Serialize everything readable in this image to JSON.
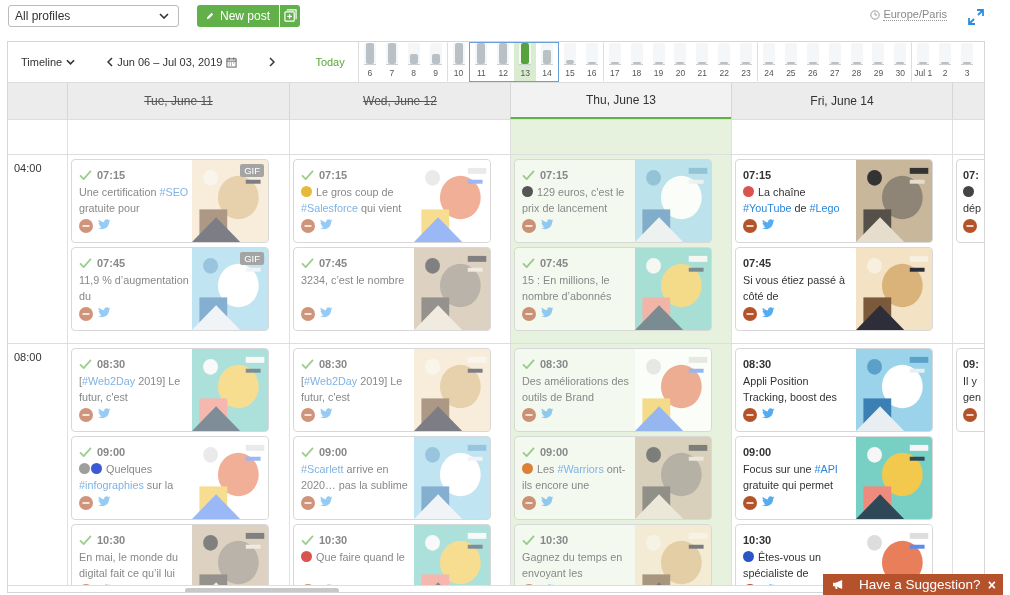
{
  "profile_select": {
    "value": "All profiles"
  },
  "new_post_button": {
    "label": "New post"
  },
  "timezone": "Europe/Paris",
  "toolbar": {
    "view": "Timeline",
    "date_range": "Jun 06 – Jul 03, 2019",
    "today": "Today"
  },
  "day_strip": [
    {
      "label": "6",
      "level": 1,
      "week_start": false,
      "in_range": false,
      "today": false
    },
    {
      "label": "7",
      "level": 1,
      "week_start": false,
      "in_range": false,
      "today": false
    },
    {
      "label": "8",
      "level": 0.5,
      "week_start": false,
      "in_range": false,
      "today": false
    },
    {
      "label": "9",
      "level": 0.5,
      "week_start": false,
      "in_range": false,
      "today": false
    },
    {
      "label": "10",
      "level": 1,
      "week_start": true,
      "in_range": false,
      "today": false
    },
    {
      "label": "11",
      "level": 1,
      "week_start": false,
      "in_range": true,
      "today": false
    },
    {
      "label": "12",
      "level": 1,
      "week_start": false,
      "in_range": true,
      "today": false
    },
    {
      "label": "13",
      "level": 1,
      "week_start": false,
      "in_range": true,
      "today": true
    },
    {
      "label": "14",
      "level": 0.65,
      "week_start": false,
      "in_range": true,
      "today": false
    },
    {
      "label": "15",
      "level": 0.2,
      "week_start": false,
      "in_range": false,
      "today": false
    },
    {
      "label": "16",
      "level": 0,
      "week_start": false,
      "in_range": false,
      "today": false
    },
    {
      "label": "17",
      "level": 0,
      "week_start": true,
      "in_range": false,
      "today": false
    },
    {
      "label": "18",
      "level": 0,
      "week_start": false,
      "in_range": false,
      "today": false
    },
    {
      "label": "19",
      "level": 0,
      "week_start": false,
      "in_range": false,
      "today": false
    },
    {
      "label": "20",
      "level": 0,
      "week_start": false,
      "in_range": false,
      "today": false
    },
    {
      "label": "21",
      "level": 0,
      "week_start": false,
      "in_range": false,
      "today": false
    },
    {
      "label": "22",
      "level": 0,
      "week_start": false,
      "in_range": false,
      "today": false
    },
    {
      "label": "23",
      "level": 0,
      "week_start": false,
      "in_range": false,
      "today": false
    },
    {
      "label": "24",
      "level": 0,
      "week_start": true,
      "in_range": false,
      "today": false
    },
    {
      "label": "25",
      "level": 0,
      "week_start": false,
      "in_range": false,
      "today": false
    },
    {
      "label": "26",
      "level": 0,
      "week_start": false,
      "in_range": false,
      "today": false
    },
    {
      "label": "27",
      "level": 0,
      "week_start": false,
      "in_range": false,
      "today": false
    },
    {
      "label": "28",
      "level": 0,
      "week_start": false,
      "in_range": false,
      "today": false
    },
    {
      "label": "29",
      "level": 0,
      "week_start": false,
      "in_range": false,
      "today": false
    },
    {
      "label": "30",
      "level": 0,
      "week_start": false,
      "in_range": false,
      "today": false
    },
    {
      "label": "Jul 1",
      "level": 0,
      "week_start": true,
      "in_range": false,
      "today": false
    },
    {
      "label": "2",
      "level": 0,
      "week_start": false,
      "in_range": false,
      "today": false
    },
    {
      "label": "3",
      "level": 0,
      "week_start": false,
      "in_range": false,
      "today": false
    }
  ],
  "time_slots": [
    "04:00",
    "08:00"
  ],
  "columns": [
    {
      "header": "Tue, June 11",
      "past": true,
      "today": false,
      "slots": [
        [
          {
            "time": "07:15",
            "published": true,
            "badge": "GIF",
            "text": [
              {
                "text": "Une certification "
              },
              {
                "kind": "hashtag",
                "text": "#SEO"
              },
              {
                "text": " gratuite pour"
              }
            ]
          },
          {
            "time": "07:45",
            "published": true,
            "badge": "GIF",
            "text": [
              {
                "text": "11,9 % d’augmentation du"
              }
            ]
          }
        ],
        [
          {
            "time": "08:30",
            "published": true,
            "text": [
              {
                "text": "["
              },
              {
                "kind": "hashtag",
                "text": "#Web2Day"
              },
              {
                "text": " 2019] Le futur, c'est"
              }
            ]
          },
          {
            "time": "09:00",
            "published": true,
            "text": [
              {
                "kind": "emoji",
                "color": "#9e9e9e"
              },
              {
                "kind": "emoji",
                "color": "#3b5bd6"
              },
              {
                "text": " Quelques "
              },
              {
                "kind": "hashtag",
                "text": "#infographies"
              },
              {
                "text": " sur la"
              }
            ]
          },
          {
            "time": "10:30",
            "published": true,
            "text": [
              {
                "text": "En mai, le monde du digital fait ce qu’il lui"
              }
            ]
          }
        ]
      ]
    },
    {
      "header": "Wed, June 12",
      "past": true,
      "today": false,
      "slots": [
        [
          {
            "time": "07:15",
            "published": true,
            "text": [
              {
                "kind": "emoji",
                "color": "#e6b93b"
              },
              {
                "text": " Le gros coup de "
              },
              {
                "kind": "hashtag",
                "text": "#Salesforce"
              },
              {
                "text": " qui vient"
              }
            ]
          },
          {
            "time": "07:45",
            "published": true,
            "text": [
              {
                "text": "3234, c’est le nombre"
              }
            ]
          }
        ],
        [
          {
            "time": "08:30",
            "published": true,
            "text": [
              {
                "text": "["
              },
              {
                "kind": "hashtag",
                "text": "#Web2Day"
              },
              {
                "text": " 2019] Le futur, c'est"
              }
            ]
          },
          {
            "time": "09:00",
            "published": true,
            "text": [
              {
                "kind": "hashtag",
                "text": "#Scarlett"
              },
              {
                "text": " arrive en 2020… pas la sublime"
              }
            ]
          },
          {
            "time": "10:30",
            "published": true,
            "text": [
              {
                "kind": "emoji",
                "color": "#d9534f"
              },
              {
                "text": " Que faire quand le"
              }
            ]
          }
        ]
      ]
    },
    {
      "header": "Thu, June 13",
      "past": false,
      "today": true,
      "slots": [
        [
          {
            "time": "07:15",
            "published": true,
            "text": [
              {
                "kind": "emoji",
                "color": "#555555"
              },
              {
                "text": " 129 euros, c'est le prix de lancement"
              }
            ]
          },
          {
            "time": "07:45",
            "published": true,
            "text": [
              {
                "text": "15 : En millions, le nombre d’abonnés"
              }
            ]
          }
        ],
        [
          {
            "time": "08:30",
            "published": true,
            "text": [
              {
                "text": "Des améliorations des outils de Brand"
              }
            ]
          },
          {
            "time": "09:00",
            "published": true,
            "text": [
              {
                "kind": "emoji",
                "color": "#d9813b"
              },
              {
                "text": " Les "
              },
              {
                "kind": "hashtag",
                "text": "#Warriors"
              },
              {
                "text": " ont-ils encore une"
              }
            ]
          },
          {
            "time": "10:30",
            "published": true,
            "text": [
              {
                "text": "Gagnez du temps en envoyant les"
              }
            ]
          }
        ]
      ]
    },
    {
      "header": "Fri, June 14",
      "past": false,
      "today": false,
      "slots": [
        [
          {
            "time": "07:15",
            "published": false,
            "text": [
              {
                "kind": "emoji",
                "color": "#d9534f"
              },
              {
                "text": " La chaîne "
              },
              {
                "kind": "hashtag",
                "text": "#YouTube"
              },
              {
                "text": " de "
              },
              {
                "kind": "hashtag",
                "text": "#Lego"
              }
            ]
          },
          {
            "time": "07:45",
            "published": false,
            "text": [
              {
                "text": "Si vous étiez passé à côté de"
              }
            ]
          }
        ],
        [
          {
            "time": "08:30",
            "published": false,
            "text": [
              {
                "text": "Appli Position Tracking, boost des"
              }
            ]
          },
          {
            "time": "09:00",
            "published": false,
            "text": [
              {
                "text": "Focus sur une "
              },
              {
                "kind": "hashtag",
                "text": "#API"
              },
              {
                "text": " gratuite qui permet"
              }
            ]
          },
          {
            "time": "10:30",
            "published": false,
            "text": [
              {
                "kind": "emoji",
                "color": "#2a56c6"
              },
              {
                "text": " Êtes-vous un spécialiste de"
              }
            ]
          }
        ]
      ]
    },
    {
      "slots": [
        [
          {
            "time": "07:",
            "published": false,
            "text": [
              {
                "kind": "emoji",
                "color": "#444444"
              },
              {
                "text": " dép"
              }
            ]
          }
        ],
        [
          {
            "time": "09:",
            "published": false,
            "text": [
              {
                "text": "Il y gen"
              }
            ]
          }
        ]
      ]
    }
  ],
  "suggestion": {
    "label": "Have a Suggestion?",
    "close": "×"
  }
}
